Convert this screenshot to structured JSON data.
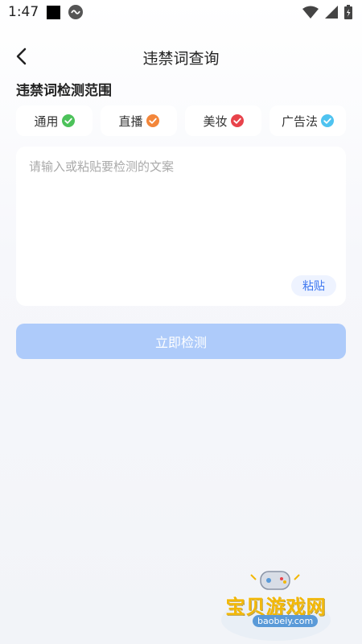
{
  "status_bar": {
    "time": "1:47",
    "icons": [
      "square-icon",
      "app-circle-icon",
      "wifi-icon",
      "signal-icon",
      "battery-icon"
    ]
  },
  "nav": {
    "title": "违禁词查询",
    "back_icon": "back-chevron-icon"
  },
  "section": {
    "title": "违禁词检测范围"
  },
  "scopes": [
    {
      "label": "通用",
      "check_color": "#4cc25a"
    },
    {
      "label": "直播",
      "check_color": "#f3863a"
    },
    {
      "label": "美妆",
      "check_color": "#e8434b"
    },
    {
      "label": "广告法",
      "check_color": "#4fc3f0"
    }
  ],
  "input": {
    "placeholder": "请输入或粘贴要检测的文案",
    "value": "",
    "paste_label": "粘贴"
  },
  "action": {
    "detect_label": "立即检测"
  },
  "watermark": {
    "text": "宝贝游戏网",
    "url": "baobeiy.com"
  }
}
